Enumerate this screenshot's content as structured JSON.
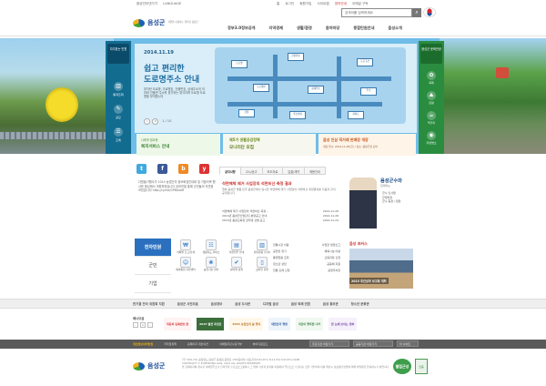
{
  "util": {
    "left": [
      "음성인터넷가기",
      "LANGUAGE"
    ],
    "right": [
      "홈",
      "로그인",
      "회원가입",
      "사이트맵",
      "영어안내",
      "이메일 구독"
    ]
  },
  "header": {
    "logo_text": "음성군",
    "slogan": "자연을 사랑하는 행복한 음성군",
    "search_placeholder": "검색어를 입력하세요",
    "gnb": [
      "정부3.0정보공개",
      "지역경제",
      "생활/환경",
      "참여마당",
      "종합민원안내",
      "음성소개"
    ]
  },
  "leftnav": {
    "title": "자주찾는 민원",
    "items": [
      "통계조회",
      "공모",
      "조례"
    ]
  },
  "rightnav": {
    "title": "음성군 문화관광",
    "items": [
      "축제",
      "관광",
      "먹거리",
      "주변명소"
    ]
  },
  "hero": {
    "date": "2014.11.19",
    "title1": "쉽고 편리한",
    "title2": "도로명주소 안내",
    "desc": "부지런 도로명, 가로명호, 건물번호, 상세주소의 의미와 건물번 주소를 표기하는 방식이며 도로명 도로명을 부여합니다",
    "num": "1 / 10",
    "tiles": [
      "도로명",
      "건물번호",
      "도로구간",
      "도로명판",
      "상세주소",
      "주소",
      "건물",
      "주소안내",
      "지하도"
    ]
  },
  "promos": {
    "p1_small": "나에게 필요한",
    "p1_big": "복지서비스 안내",
    "p2_small": "제5기 생활공감정책",
    "p2_big": "모니터단 모집",
    "p3_big": "음성 인삼 직거래 판매장 개장",
    "p3_small": "개장 일시: 2014.11.28(금) / 장소: 음성군청 로비"
  },
  "sns": {
    "icons": [
      "t",
      "f",
      "b",
      "y"
    ],
    "text": "다원들기행사가 2014 농업인의 정보화경진대회 및 가뭄극복 행사를 음성에서 개최하였습니다 공모전을 통해 군민들의 의견을 모았습니다 http://ry.me/GP6A4aH"
  },
  "news": {
    "tabs": [
      "공지사항",
      "고시/공고",
      "보도자료",
      "입찰/계약",
      "채용안내"
    ],
    "head": "석면해체 제거 사업장의 석면비산 측정 결과",
    "body": "행복 음성군 명품 민주 음성군에서 실시한 석면해체 제거 사업장의 석면비산 측정결과를 다음과 같이 공개합니다",
    "items": [
      [
        "석면해체 제거 사업장의 석면비산 측정...",
        "2014.11.26"
      ],
      [
        "2014년 음성군산업단지 분양공고 안내",
        "2014.11.26"
      ],
      [
        "2015년 음성교육청 장학생 선발 공고",
        "2014.11.24"
      ]
    ]
  },
  "mayor": {
    "title": "음성군수와",
    "sub": "함께하는",
    "links": [
      "군수 인사말",
      "군정방향",
      "군수 동정 / 일정"
    ]
  },
  "quick": {
    "tabs": [
      "전자민원",
      "군민",
      "기업"
    ],
    "items": [
      "작목별 신고/납세",
      "생활지도 서비스",
      "여권업무 안내",
      "민원편람 (전자)",
      "육아종합 지원센터",
      "농업기술 센터",
      "분야별 정책",
      "모바일 민원"
    ],
    "links": [
      "전통시장 이용",
      "공연장 찾기",
      "통행현황 조회",
      "청소년 상담",
      "전통 혼례 신청",
      "공영주차장"
    ],
    "links2": [
      "사업장 영업신고",
      "체육시설 이용",
      "교육과정 신청",
      "공동체 지원"
    ]
  },
  "notice": {
    "title": "음성 포커스",
    "caption": "2015 추진성과 보고회 개최"
  },
  "sitebar": {
    "items": [
      "반기결 전국 위원회 지원",
      "음성군 사진모음",
      "음성경보",
      "음성 도서관",
      "디지털 음성",
      "음성 축제 민원",
      "음성 홍보관",
      "청소년 문화관"
    ]
  },
  "banners": {
    "label": "배너모음",
    "items": [
      "자동차 등록번호 판",
      "2015 발전 추진단",
      "2015 농업인의 날 행사",
      "대한민국 행정",
      "국민이 행복한 나라",
      "한 눈에 보이는 정부"
    ]
  },
  "footer_nav": {
    "items": [
      "개인정보처리방침",
      "저작권정책",
      "홈페이지 개선의견",
      "이메일무단수집거부",
      "뷰어다운로드"
    ],
    "selects": [
      "주요기관 바로가기",
      "공공기관 바로가기",
      "타 사이트"
    ]
  },
  "footer": {
    "logo_text": "음성군",
    "address": "(우) 369-701 충청북도 음성군 음성읍 중앙로 158(읍내리) 대표전화 043-871-3114 FAX 043-871-3188",
    "copyright": "COPYRIGHT © EUMSEONG GUN, 2014 ALL RIGHTS RESERVED",
    "note": "본 홈페이지에 게시된 이메일주소가 전자우편 수집프로그램이나 그 밖의 기술적 장치를 이용하여 무단으로 수집되는 것을 거부하며 이를 위반시 정보통신망법에 의해 처벌됨을 유념하시기 바랍니다",
    "cert1": "웹접근성",
    "cert2": "인증"
  },
  "colors": {
    "leftnav": "#126c90",
    "rightnav": "#2a8c3f",
    "brand_blue": "#1d4f9a",
    "accent_red": "#cc3333"
  }
}
